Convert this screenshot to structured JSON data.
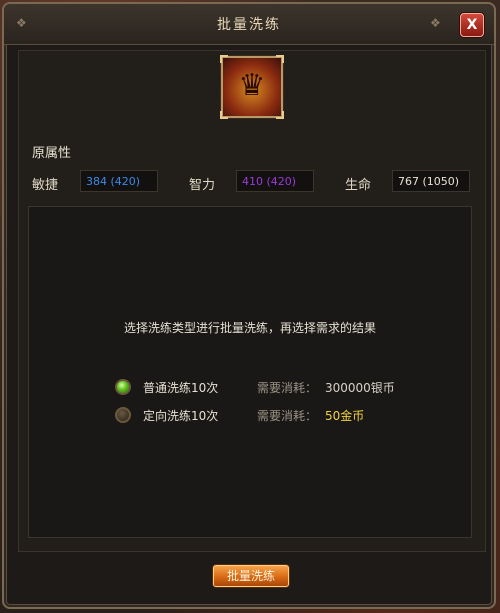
{
  "dialog": {
    "title": "批量洗练",
    "close_label": "X"
  },
  "hero": {
    "icon": "warrior-portrait-icon"
  },
  "attributes": {
    "section_label": "原属性",
    "items": [
      {
        "label": "敏捷",
        "value": "384 (420)",
        "color": "#3a8ae8"
      },
      {
        "label": "智力",
        "value": "410 (420)",
        "color": "#9a3ad8"
      },
      {
        "label": "生命",
        "value": "767 (1050)",
        "color": "#e8e2d0"
      }
    ]
  },
  "panel": {
    "prompt": "选择洗练类型进行批量洗练，再选择需求的结果"
  },
  "options": [
    {
      "label": "普通洗练10次",
      "cost_label": "需要消耗：",
      "cost_value": "300000银币",
      "selected": true,
      "cost_color": "#d8d2c4"
    },
    {
      "label": "定向洗练10次",
      "cost_label": "需要消耗：",
      "cost_value": "50金币",
      "selected": false,
      "cost_color": "#f0d040"
    }
  ],
  "actions": {
    "batch_button": "批量洗练"
  }
}
